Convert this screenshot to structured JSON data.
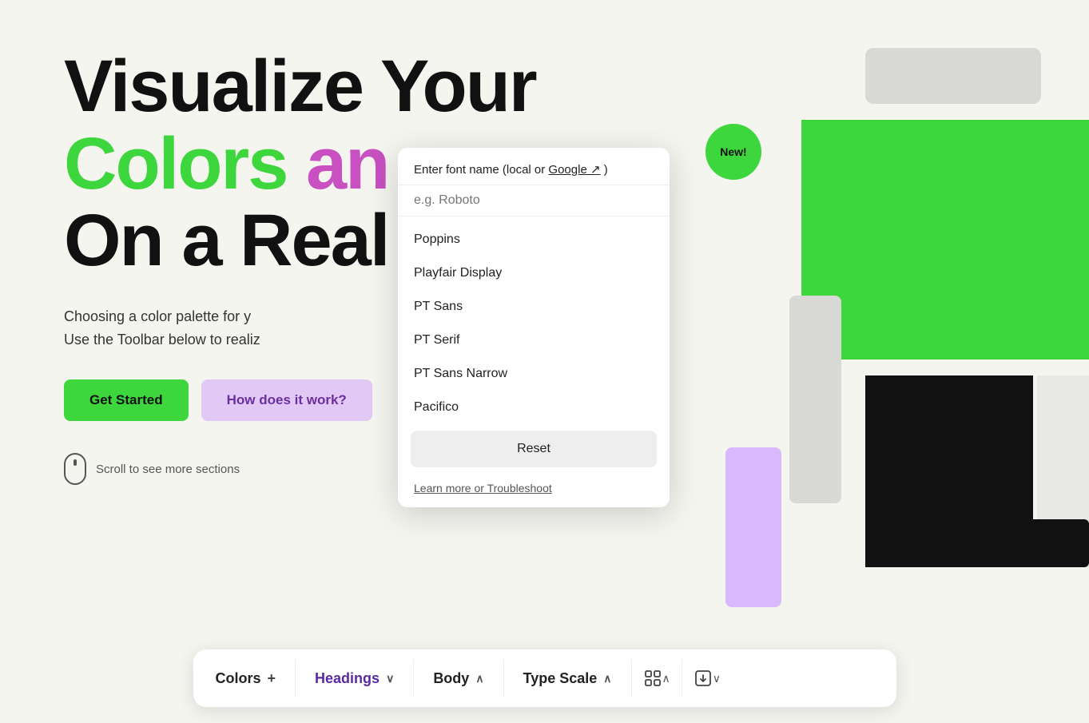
{
  "hero": {
    "title_line1": "Visualize Your",
    "title_line2_word1": "Colors",
    "title_line2_word2": "an",
    "title_line3": "On a Real",
    "subtitle_line1": "Choosing a color palette for y",
    "subtitle_line2": "Use the Toolbar below to realiz",
    "btn_get_started": "Get Started",
    "btn_how_it_works": "How does it work?",
    "scroll_hint": "Scroll to see more sections"
  },
  "new_badge": "New!",
  "font_dropdown": {
    "header": "Enter font name (local or Google",
    "header_link": "Google",
    "header_suffix": ")",
    "placeholder": "e.g. Roboto",
    "fonts": [
      "Poppins",
      "Playfair Display",
      "PT Sans",
      "PT Serif",
      "PT Sans Narrow",
      "Pacifico"
    ],
    "reset_label": "Reset",
    "learn_link": "Learn more or Troubleshoot"
  },
  "toolbar": {
    "colors_label": "Colors",
    "colors_icon": "+",
    "headings_label": "Headings",
    "body_label": "Body",
    "type_scale_label": "Type Scale",
    "chevron_down": "∨",
    "chevron_up": "∧"
  },
  "colors": {
    "accent": "#3dd63d",
    "purple": "#c850c0",
    "purple_light": "#d8b8ff",
    "black": "#111111",
    "gray_light": "#d8d8d4"
  }
}
